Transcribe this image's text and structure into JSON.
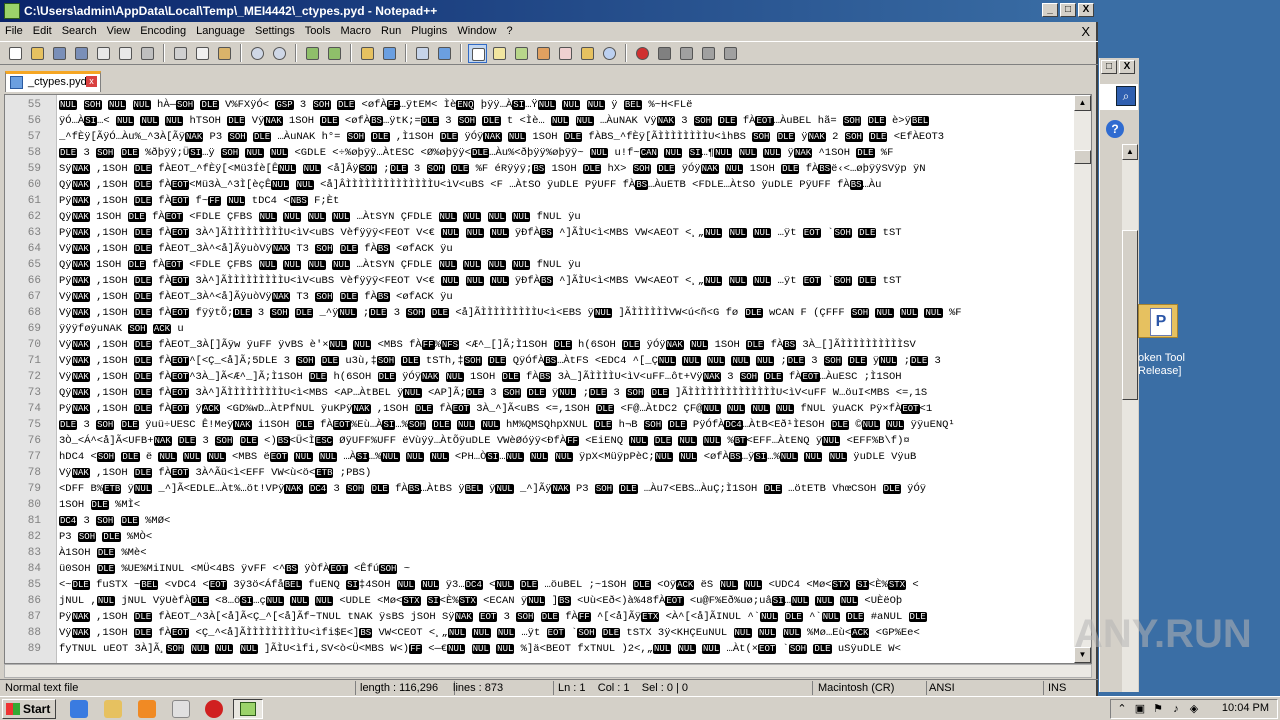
{
  "window": {
    "title": "C:\\Users\\admin\\AppData\\Local\\Temp\\_MEI4442\\_ctypes.pyd - Notepad++",
    "min_label": "_",
    "max_label": "□",
    "close_label": "X"
  },
  "menu": {
    "items": [
      "File",
      "Edit",
      "Search",
      "View",
      "Encoding",
      "Language",
      "Settings",
      "Tools",
      "Macro",
      "Run",
      "Plugins",
      "Window",
      "?"
    ],
    "close_doc": "X"
  },
  "toolbar": {
    "icons": [
      "new-file-icon",
      "open-file-icon",
      "save-icon",
      "save-all-icon",
      "close-icon",
      "close-all-icon",
      "print-icon",
      "cut-icon",
      "copy-icon",
      "paste-icon",
      "undo-icon",
      "redo-icon",
      "find-icon",
      "replace-icon",
      "zoom-in-icon",
      "zoom-out-icon",
      "sync-vertical-icon",
      "sync-horizontal-icon",
      "word-wrap-icon",
      "show-all-chars-icon",
      "indent-guide-icon",
      "user-lang-icon",
      "doc-map-icon",
      "function-list-icon",
      "folder-workspace-icon",
      "monitor-icon",
      "record-macro-icon",
      "stop-record-icon",
      "play-macro-icon",
      "run-macro-multiple-icon",
      "save-macro-icon"
    ]
  },
  "tab": {
    "label": "_ctypes.pyd",
    "close_label": "x"
  },
  "editor": {
    "lines": [
      {
        "n": "55",
        "text": "NUL SOH NUL NUL hÀ—SOH DLE V%FXÿÓ< GSP 3 SOH DLE <øfÀFF…ÿtEM< ÌèENQ þÿÿ…ÀSI…ŸNUL NUL NUL ÿ BEL %~H<FLë"
      },
      {
        "n": "56",
        "text": "ÿÓ…ÀSI…< NUL NUL NUL hTSOH DLE VÿNAK 1SOH DLE <øfÀBS…ÿtK;=DLE 3 SOH DLE t <Ìè… NUL NUL …ÀuNAK VÿNAK 3 SOH DLE fÀEOT…ÀuBEL hã= SOH DLE è>ÿBEL"
      },
      {
        "n": "57",
        "text": "_^fÈÿ[ÃÿÓ…Àu%_^3À[ÃÿNAK P3 SOH DLE …ÀuNAK h°= SOH DLE ,Ì1SOH DLE ÿÓÿNAK NUL 1SOH DLE fÀBS_^fÈÿ[ÃÌÌÌÌÌÌÌÌU<ìhBS SOH DLE ÿNAK 2 SOH DLE <EfÀEOT3"
      },
      {
        "n": "58",
        "text": "DLE 3 SOH DLE %ðþÿÿ;ÜSI…ÿ SOH NUL NUL <GDLE <÷%øþÿÿ…ÀtESC <Ø%øþÿÿ<DLE…Àu%<ðþÿÿ%øþÿÿ~ NUL u!f~CAN NUL SI…¶NUL NUL NUL ÿNAK ^1SOH DLE %F"
      },
      {
        "n": "59",
        "text": "SÿNAK ,1SOH DLE fÀEOT_^fÈÿ[<Mü3Íè[ÊNUL NUL <å]ÂÿSOH ;DLE 3 SOH DLE %F éRÿÿÿ;BS 1SOH DLE hX> SOH DLE ÿÓÿNAK NUL 1SOH DLE fÀBSë‹<…øþÿÿSVÿp ÿN"
      },
      {
        "n": "60",
        "text": "QÿNAK ,1SOH DLE fÀEOT<Mü3À_^3Ì[èçÊNUL NUL <å]ÂÌÌÌÌÌÌÌÌÌÌÌÌÌÌU<ìV<uBS <F …ÀtSO ÿuDLE PÿUFF fÀBS…ÀuETB <FDLE…ÀtSO ÿuDLE PÿUFF fÀBS…Àu"
      },
      {
        "n": "61",
        "text": "PÿNAK ,1SOH DLE fÀEOT f~FF NUL tDC4 <NBS F;Èt"
      },
      {
        "n": "62",
        "text": "QÿNAK 1SOH DLE fÀEOT <FDLE ÇFBS NUL NUL NUL NUL …ÀtSYN ÇFDLE NUL NUL NUL NUL fNUL ÿu"
      },
      {
        "n": "63",
        "text": "PÿNAK ,1SOH DLE fÀEOT 3À^]ÃÌÌÌÌÌÌÌÌÌU<ìV<uBS Vèfÿÿÿ<FEOT V<€ NUL NUL NUL ÿÐfÀBS ^]ÃÌU<ì<MBS VW<AEOT <¸„NUL NUL NUL …ÿt EOT `SOH DLE tST"
      },
      {
        "n": "64",
        "text": "VÿNAK ,1SOH DLE fÀEOT_3À^<å]ÃÿuòVÿNAK T3 SOH DLE fÀBS <øfACK ÿu"
      },
      {
        "n": "65",
        "text": "QÿNAK 1SOH DLE fÀEOT <FDLE ÇFBS NUL NUL NUL NUL …ÀtSYN ÇFDLE NUL NUL NUL NUL fNUL ÿu"
      },
      {
        "n": "66",
        "text": "PÿNAK ,1SOH DLE fÀEOT 3À^]ÃÌÌÌÌÌÌÌÌÌU<ìV<uBS Vèfÿÿÿ<FEOT V<€ NUL NUL NUL ÿÐfÀBS ^]ÃÌU<ì<MBS VW<AEOT <¸„NUL NUL NUL …ÿt EOT `SOH DLE tST"
      },
      {
        "n": "67",
        "text": "VÿNAK ,1SOH DLE fÀEOT_3À^<å]ÃÿuòVÿNAK T3 SOH DLE fÀBS <øfACK ÿu"
      },
      {
        "n": "68",
        "text": "VÿNAK ,1SOH DLE fÀEOT fÿÿtÕ;DLE 3 SOH DLE _^ÿNUL ;DLE 3 SOH DLE <å]ÃÌÌÌÌÌÌÌÌÌU<ì<EBS ÿNUL ]ÃÌÌÌÌÌÌVW<ú<ñ<G fø DLE wCAN F (ÇFFF SOH NUL NUL NUL %F"
      },
      {
        "n": "69",
        "text": "ÿÿÿføÿuNAK SOH ACK u"
      },
      {
        "n": "70",
        "text": "VÿNAK ,1SOH DLE fÀEOT_3À[]Ãÿw ÿuFF ÿvBS è'×NUL NUL <MBS fÀFF%NFS <Æ^_[]Ã;Ì1SOH DLE h(6SOH DLE ÿÓÿNAK NUL 1SOH DLE fÀBS 3À_[]ÃÌÌÌÌÌÌÌÌÌÌSV"
      },
      {
        "n": "71",
        "text": "VÿNAK ,1SOH DLE fÀEOT^[<Ç_<å]Ã;5DLE 3 SOH DLE u3ù,‡SOH DLE tSTh,‡SOH DLE QÿÓfÀBS…ÀtFS <EDC4 ^[_ÇNUL NUL NUL NUL NUL ;DLE 3 SOH DLE ÿNUL ;DLE 3"
      },
      {
        "n": "72",
        "text": "VÿNAK ,1SOH DLE fÀEOT^3À_]Ã<Æ^_]Ã;Ì1SOH DLE h(6SOH DLE ÿÓÿNAK NUL 1SOH DLE fÀBS 3À_]ÃÌÌÌÌU<ìV<uFF…ôt+VÿNAK 3 SOH DLE fÀEOT…ÀuESC ;Ì1SOH"
      },
      {
        "n": "73",
        "text": "QÿNAK ,1SOH DLE fÀEOT 3À^]ÃÌÌÌÌÌÌÌÌÌU<ì<MBS <AP…ÀtBEL ÿNUL <AP]Ã;DLE 3 SOH DLE ÿNUL ;DLE 3 SOH DLE ]ÃÌÌÌÌÌÌÌÌÌÌÌÌÌÌU<ìV<uFF W…öuI<MBS <=,1S"
      },
      {
        "n": "74",
        "text": "PÿNAK ,1SOH DLE fÀEOT ÿACK <GD%wD…ÀtPfNUL ÿuKPÿNAK ,1SOH DLE fÀEOT 3À_^]Ã<uBS <=,1SOH DLE <F@…ÀtDC2 ÇF@NUL NUL NUL NUL fNUL ÿuACK Pÿ×fÀEOT<1"
      },
      {
        "n": "75",
        "text": "DLE 3 SOH DLE ÿuü÷UESC Ê!MeÿNAK i1SOH DLE fÀEOT%Eù…ÀSI…%SOH DLE NUL NUL hM%QMSQhpXNUL DLE h¬B SOH DLE PÿÓfÀDC4…ÀtB<Eð¹ÌESOH DLE ©NUL NUL ÿÿuENQ¹"
      },
      {
        "n": "76",
        "text": "3Ò_<Á^<å]Ã<UFB+NAK DLE 3 SOH DLE <)BS<Ü<ÌESC ØÿUFF%UFF ëVùÿÿ…ÀtÕÿuDLE VWèØóÿÿ<ÐfÀFF <EiENQ NUL DLE NUL NUL %BT<EFF…ÀtENQ ÿNUL <EFF%B\\f)¤"
      },
      {
        "n": "77",
        "text": "hDC4 <SOH DLE ë NUL NUL NUL <MBS ëEOT NUL NUL …ÀSI…%NUL NUL NUL <PH…ÒSI…NUL NUL NUL ÿpX<MüÿpPèC;NUL NUL <øfÀBS…ÿSI…%NUL NUL NUL ÿuDLE VÿuB"
      },
      {
        "n": "78",
        "text": "VÿNAK ,1SOH DLE fÀEOT 3À^Ãü<ì<EFF VW<ù<ö<ETB ;PBS)"
      },
      {
        "n": "79",
        "text": "<DFF B%ETB ÿNUL _^]Ã<EDLE…Àt%…öt!VPÿNAK DC4 3 SOH DLE fÀBS…ÀtBS ÿBEL ÿNUL _^]ÃÿNAK P3 SOH DLE …Àu7<EBS…ÀuÇ;Ì1SOH DLE …ötETB VhœCSOH DLE ÿÓÿ"
      },
      {
        "n": "80",
        "text": " 1SOH DLE %MÌ<"
      },
      {
        "n": "81",
        "text": "DC4 3 SOH DLE %MØ<"
      },
      {
        "n": "82",
        "text": "P3 SOH DLE %MÒ<"
      },
      {
        "n": "83",
        "text": "À1SOH DLE %Mè<"
      },
      {
        "n": "84",
        "text": "ü0SOH DLE %UE%MiINUL <MÜ<4BS ÿvFF <^BS ÿÒfÀEOT <ÊfúSOH ~"
      },
      {
        "n": "85",
        "text": "<~DLE fuSTX ~BEL <vDC4 <EOT 3ÿ3ö<ÁfåBEL fuENQ SI‡4SOH NUL NUL ÿ3…DC4 <NUL DLE …öuBEL ;~1SOH DLE <OÿACK ëS NUL NUL <UDC4 <Mø<STX SI<È%STX <"
      },
      {
        "n": "86",
        "text": "jNUL ,NUL jNUL VÿUèfÀDLE <8…öSI…çNUL NUL NUL <UDLE <Mø<STX SI<È%STX <ECAN ÿNUL ]BS <Uù<Eð<)à%48fÀEOT <u@F%Eð%uø;uâSI…NUL NUL NUL <UÈëOþ"
      },
      {
        "n": "87",
        "text": "PÿNAK ,1SOH DLE fÀEOT_^3À[<å]Ã<Ç_^[<å]Ãf~TNUL tNAK ÿsBS jSOH SÿNAK EOT 3 SOH DLE fÀFF ^[<å]ÃÿETX <À^[<å]ÃINUL ^`NUL DLE ^`NUL DLE #aNUL DLE"
      },
      {
        "n": "88",
        "text": "VÿNAK ,1SOH DLE fÀEOT <Ç_^<å]ÃÌÌÌÌÌÌÌÌÌU<ìfi$E<]BS VW<CEOT <¸„NUL NUL NUL …ÿt EOT `SOH DLE tSTX 3ÿ<KHÇEuNUL NUL NUL NUL %Mø…Eù<ACK <GP%Ee<"
      },
      {
        "n": "89",
        "text": "fyTNUL uEOT 3À]Ã¸SOH NUL NUL NUL ]ÃÌU<ìfi,SV<ò<Ü<MBS W<)FF <—€NUL NUL NUL %]ä<BEOT fxTNUL )2<,„NUL NUL NUL …Àt(×EOT `SOH DLE uSÿuDLE W<"
      }
    ]
  },
  "status": {
    "type": "Normal text file",
    "length": "length : 116,296",
    "lines": "lines : 873",
    "position": "Ln : 1    Col : 1    Sel : 0 | 0",
    "eol": "Macintosh (CR)",
    "encoding": "ANSI",
    "mode": "INS"
  },
  "desktop": {
    "icon_label": "oken Tool\nRelease]"
  },
  "taskbar": {
    "start_label": "Start",
    "clock": "10:04 PM"
  },
  "watermark": "ANY.RUN"
}
